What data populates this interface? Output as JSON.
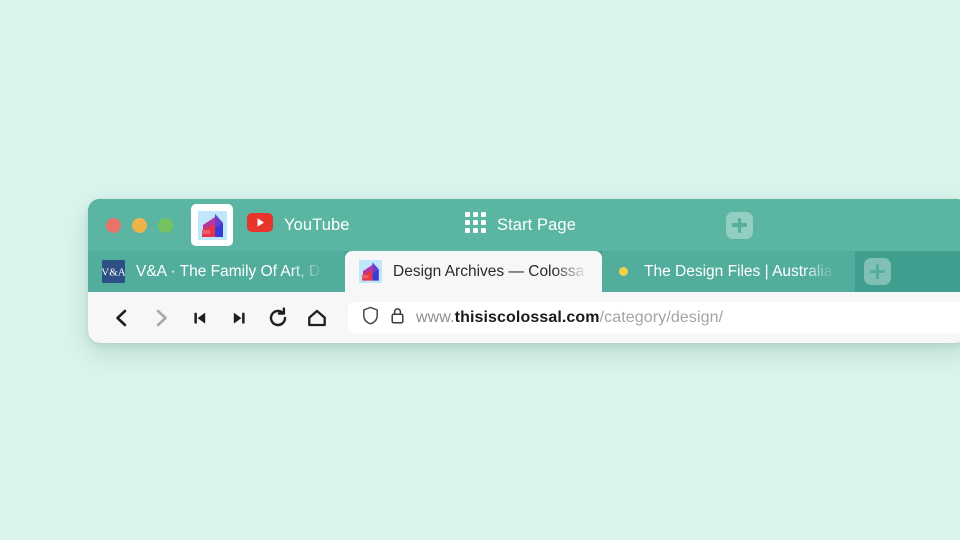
{
  "canvas": {
    "background_color": "#dbf5ed"
  },
  "window": {
    "chrome_color": "#3f9e8e",
    "topbar_color": "#5bb5a3",
    "toolbar_color": "#f7f7f7",
    "traffic_lights": [
      {
        "name": "close",
        "color": "#e8736b"
      },
      {
        "name": "minimize",
        "color": "#eeb44a"
      },
      {
        "name": "zoom",
        "color": "#74c361"
      }
    ]
  },
  "topbar": {
    "app_icon": "colossal-logo-icon",
    "items": [
      {
        "icon": "youtube-icon",
        "label": "YouTube"
      },
      {
        "icon": "grid-nine-icon",
        "label": "Start Page"
      }
    ],
    "new_tab_label": "+"
  },
  "tabstrip": {
    "tabs": [
      {
        "favicon": "va-museum-icon",
        "title": "V&A · The Family Of Art, D",
        "active": false,
        "loading": false
      },
      {
        "favicon": "colossal-icon",
        "title": "Design Archives — Colossa",
        "active": true,
        "loading": false
      },
      {
        "favicon": "loading-dot-icon",
        "title": "The Design Files | Australia",
        "active": false,
        "loading": true
      }
    ],
    "new_tab_label": "+"
  },
  "toolbar": {
    "buttons": [
      {
        "name": "back-button",
        "icon": "chevron-left-icon",
        "enabled": true
      },
      {
        "name": "forward-button",
        "icon": "chevron-right-icon",
        "enabled": false
      },
      {
        "name": "rewind-button",
        "icon": "skip-back-icon",
        "enabled": true
      },
      {
        "name": "fast-forward-button",
        "icon": "skip-forward-icon",
        "enabled": true
      },
      {
        "name": "reload-button",
        "icon": "reload-icon",
        "enabled": true
      },
      {
        "name": "home-button",
        "icon": "home-icon",
        "enabled": true
      }
    ],
    "address_bar": {
      "shield_icon": "shield-icon",
      "lock_icon": "padlock-icon",
      "url_scheme": "www.",
      "url_host": "thisiscolossal.com",
      "url_path": "/category/design/",
      "full_url": "www.thisiscolossal.com/category/design/"
    }
  }
}
